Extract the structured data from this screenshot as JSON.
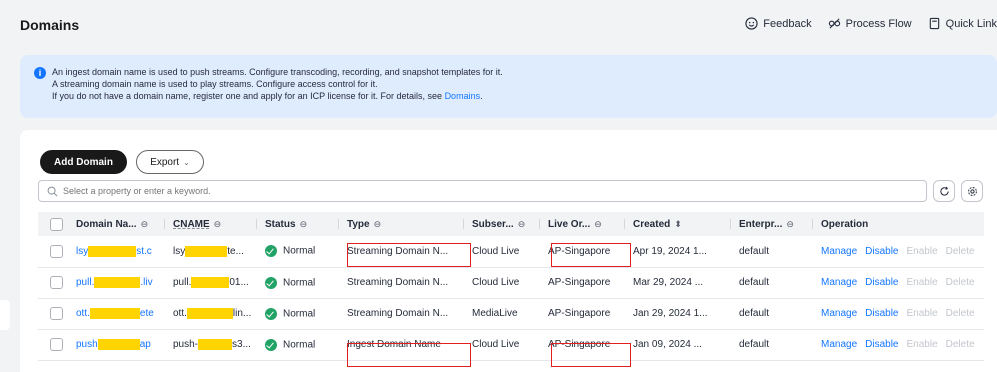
{
  "header": {
    "title": "Domains",
    "actions": [
      {
        "label": "Feedback",
        "icon": "smile-icon"
      },
      {
        "label": "Process Flow",
        "icon": "flow-icon"
      },
      {
        "label": "Quick Link",
        "icon": "doc-icon"
      }
    ]
  },
  "notice": {
    "line1": "An ingest domain name is used to push streams. Configure transcoding, recording, and snapshot templates for it.",
    "line2": "A streaming domain name is used to play streams. Configure access control for it.",
    "line3_prefix": "If you do not have a domain name, register one and apply for an ICP license for it. For details, see ",
    "line3_link": "Domains",
    "line3_suffix": "."
  },
  "toolbar": {
    "add_label": "Add Domain",
    "export_label": "Export"
  },
  "search": {
    "placeholder": "Select a property or enter a keyword."
  },
  "table": {
    "columns": {
      "domain": "Domain Na...",
      "cname": "CNAME",
      "status": "Status",
      "type": "Type",
      "subservice": "Subser...",
      "origin": "Live Or...",
      "created": "Created",
      "enterprise": "Enterpr...",
      "operation": "Operation"
    },
    "rows": [
      {
        "domain_pre": "lsy",
        "domain_suf": "st.c",
        "cname_pre": "lsy",
        "cname_suf": "te...",
        "status": "Normal",
        "type": "Streaming Domain N...",
        "subservice": "Cloud Live",
        "origin": "AP-Singapore",
        "created": "Apr 19, 2024 1...",
        "enterprise": "default"
      },
      {
        "domain_pre": "pull.",
        "domain_suf": ".liv",
        "cname_pre": "pull.",
        "cname_suf": "01...",
        "status": "Normal",
        "type": "Streaming Domain N...",
        "subservice": "Cloud Live",
        "origin": "AP-Singapore",
        "created": "Mar 29, 2024 ...",
        "enterprise": "default"
      },
      {
        "domain_pre": "ott.",
        "domain_suf": "ete",
        "cname_pre": "ott.",
        "cname_suf": "lin...",
        "status": "Normal",
        "type": "Streaming Domain N...",
        "subservice": "MediaLive",
        "origin": "AP-Singapore",
        "created": "Jan 29, 2024 1...",
        "enterprise": "default"
      },
      {
        "domain_pre": "push",
        "domain_suf": "ap",
        "cname_pre": "push-",
        "cname_suf": "s3...",
        "status": "Normal",
        "type": "Ingest Domain Name",
        "subservice": "Cloud Live",
        "origin": "AP-Singapore",
        "created": "Jan 09, 2024 ...",
        "enterprise": "default"
      }
    ],
    "operations": {
      "manage": "Manage",
      "disable": "Disable",
      "enable": "Enable",
      "delete": "Delete"
    }
  },
  "colors": {
    "accent": "#1476ff",
    "primary_button": "#191919",
    "status_ok": "#21a366",
    "highlight": "#e21f1f",
    "mask": "#ffd400"
  }
}
